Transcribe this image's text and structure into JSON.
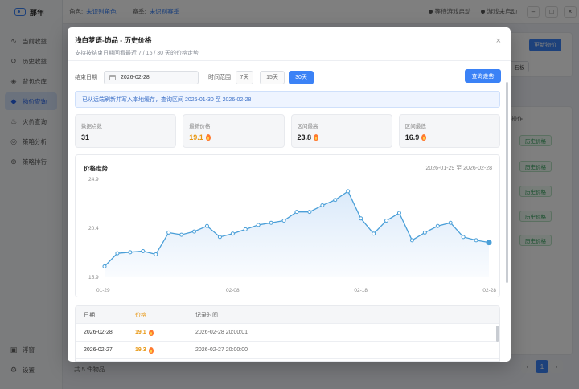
{
  "app": {
    "name": "那年"
  },
  "topbar": {
    "role_label": "角色:",
    "role_value": "未识别角色",
    "season_label": "赛季:",
    "season_value": "未识别赛季",
    "status1": "等待游戏启动",
    "status2": "游戏未启动"
  },
  "sidebar": {
    "items": [
      {
        "label": "当前收益",
        "icon": "trend-icon"
      },
      {
        "label": "历史收益",
        "icon": "history-icon"
      },
      {
        "label": "背包仓库",
        "icon": "box-icon"
      },
      {
        "label": "物价查询",
        "icon": "tag-icon",
        "active": true
      },
      {
        "label": "火价查询",
        "icon": "fire-icon"
      },
      {
        "label": "策略分析",
        "icon": "compass-icon"
      },
      {
        "label": "策略排行",
        "icon": "globe-icon"
      }
    ],
    "bottom": [
      {
        "label": "浮窗",
        "icon": "window-icon"
      },
      {
        "label": "设置",
        "icon": "gear-icon"
      }
    ]
  },
  "background": {
    "update_btn": "更新物价",
    "small_btn": "石板",
    "col_header": "操作",
    "history_btn": "历史价格",
    "footer": "共 5 件物品",
    "page": "1",
    "prev": "‹",
    "next": "›"
  },
  "modal": {
    "title": "浅白梦语-饰品 - 历史价格",
    "subtitle": "支持按结束日期回看最近 7 / 15 / 30 天的价格走势",
    "close": "×",
    "end_date_label": "结束日期",
    "end_date": "2026-02-28",
    "range_label": "时间范围",
    "ranges": [
      "7天",
      "15天",
      "30天"
    ],
    "query_btn": "查询走势",
    "notice": "已从远端刷新并写入本地缓存，查询区间 2026-01-30 至 2026-02-28",
    "stats": [
      {
        "label": "数据点数",
        "value": "31",
        "fire": false
      },
      {
        "label": "最新价格",
        "value": "19.1",
        "fire": true
      },
      {
        "label": "区间最高",
        "value": "23.8",
        "fire": true
      },
      {
        "label": "区间最低",
        "value": "16.9",
        "fire": true
      }
    ],
    "chart_title": "价格走势",
    "chart_range": "2026-01-29 至 2026-02-28",
    "table": {
      "headers": [
        "日期",
        "价格",
        "记录时间"
      ],
      "rows": [
        {
          "date": "2026-02-28",
          "price": "19.1",
          "time": "2026-02-28 20:00:01"
        },
        {
          "date": "2026-02-27",
          "price": "19.3",
          "time": "2026-02-27 20:00:00"
        }
      ]
    }
  },
  "chart_data": {
    "type": "area",
    "y_ticks": [
      "24.9",
      "20.4",
      "15.9"
    ],
    "x_ticks": [
      "01-29",
      "02-08",
      "02-18",
      "02-28"
    ],
    "ylim": [
      15.9,
      24.9
    ],
    "values": [
      16.9,
      18.1,
      18.2,
      18.3,
      18.0,
      20.0,
      19.8,
      20.1,
      20.6,
      19.6,
      19.9,
      20.3,
      20.7,
      20.9,
      21.1,
      21.9,
      21.9,
      22.5,
      23.0,
      23.8,
      21.3,
      19.9,
      21.1,
      21.8,
      19.3,
      20.0,
      20.6,
      20.9,
      19.6,
      19.3,
      19.1
    ],
    "color": "#4a9fd8",
    "fill": "#dbeafa"
  }
}
